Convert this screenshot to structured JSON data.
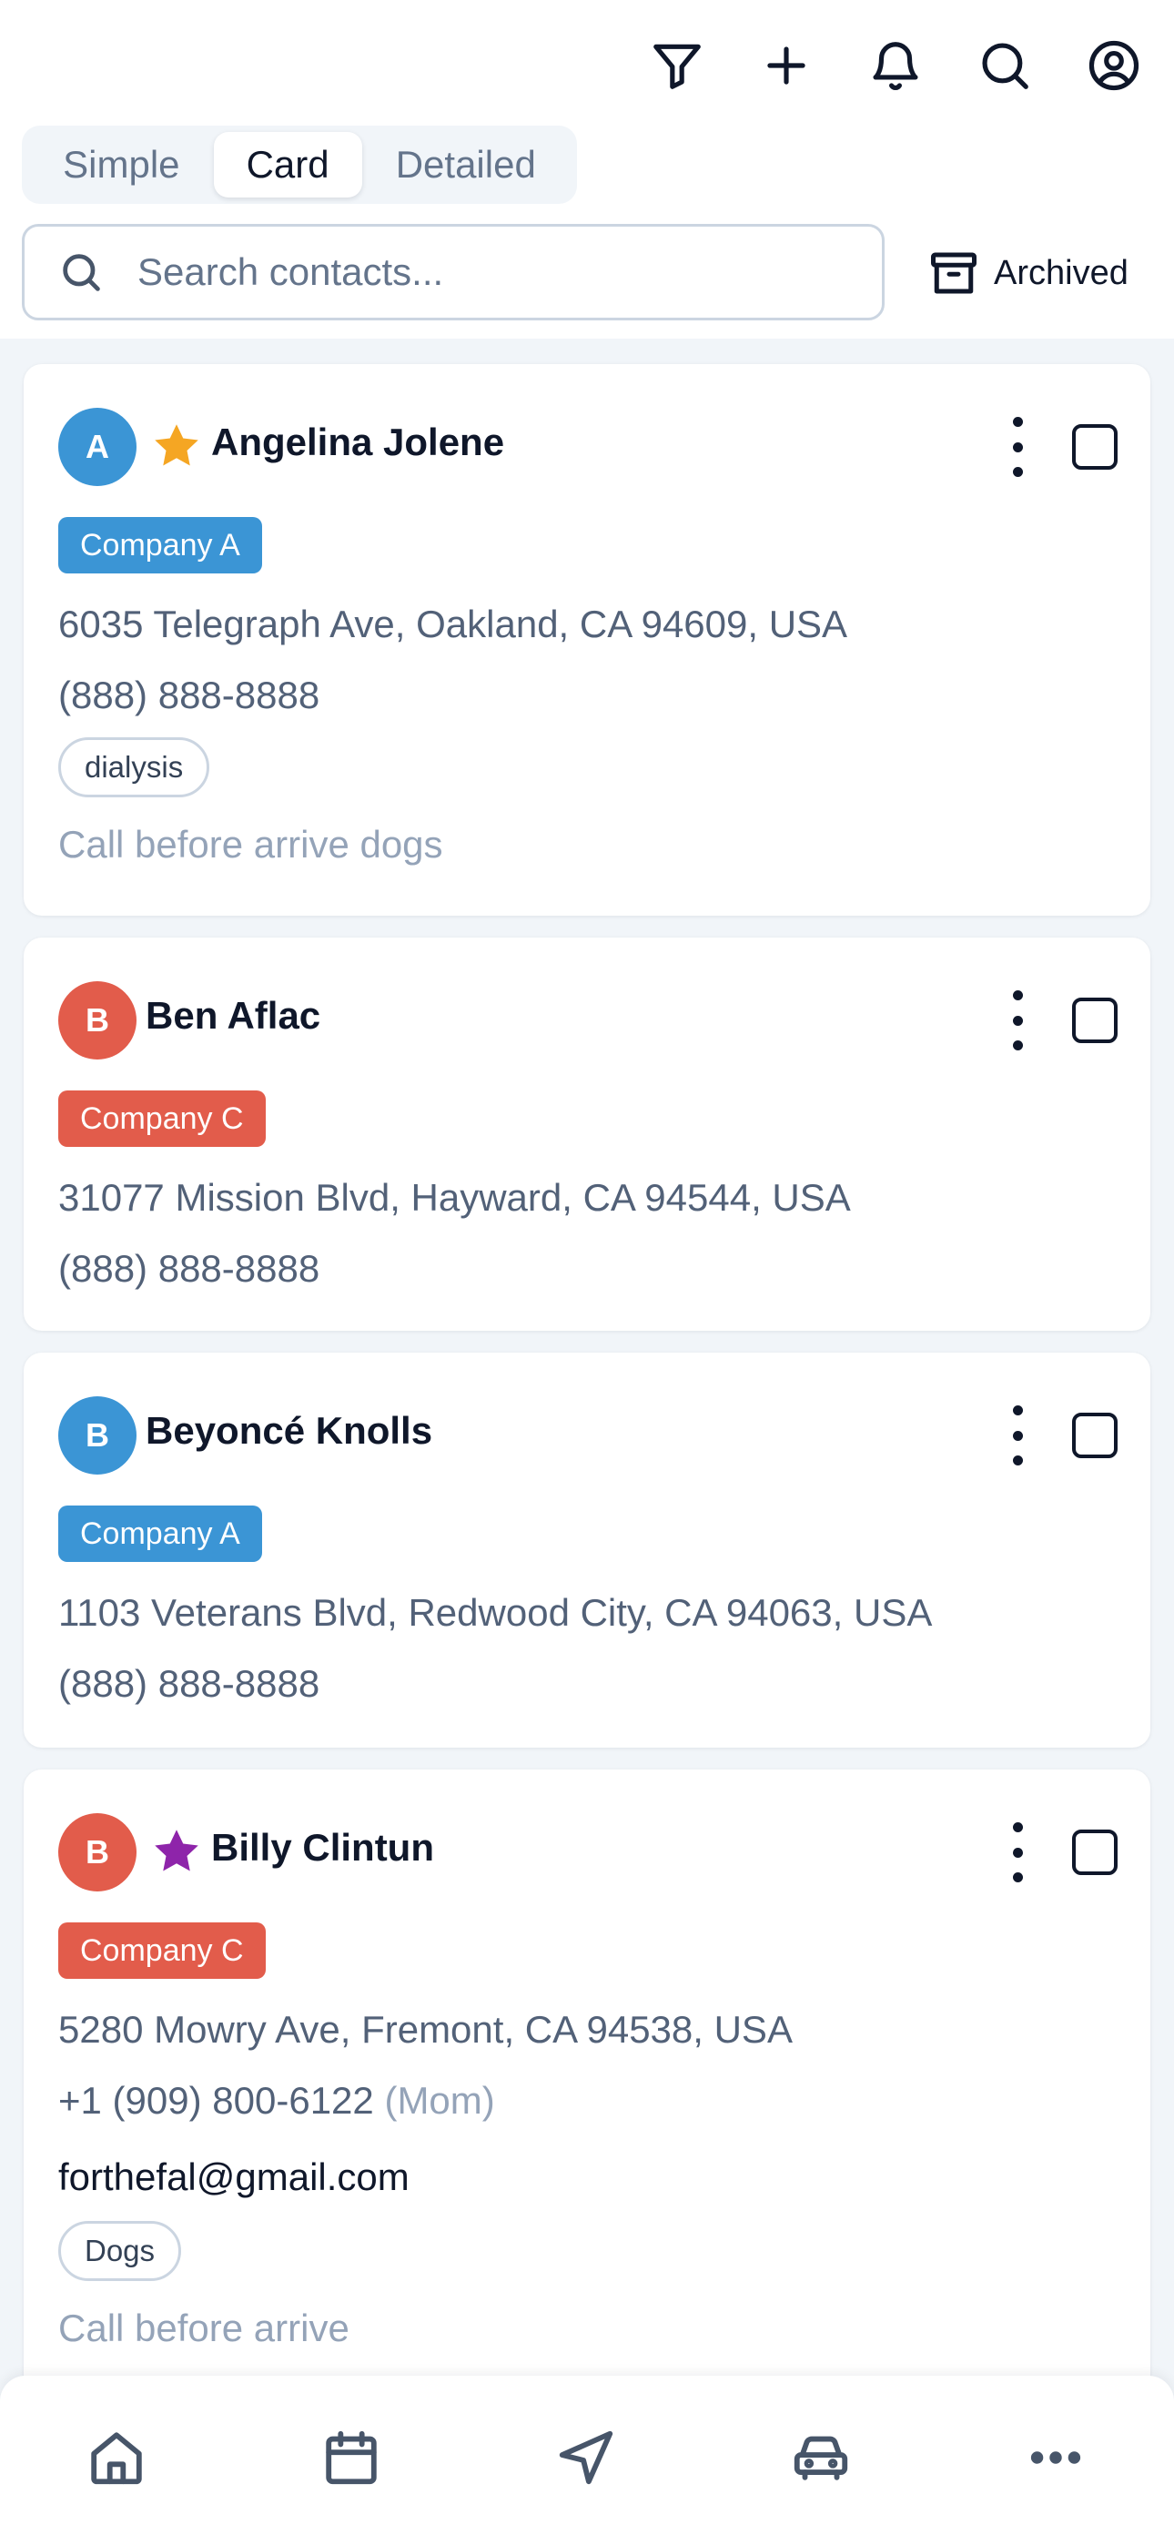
{
  "header": {
    "icons": [
      "filter-icon",
      "plus-icon",
      "bell-icon",
      "search-icon",
      "account-icon"
    ]
  },
  "view_toggle": {
    "tabs": [
      {
        "label": "Simple",
        "active": false
      },
      {
        "label": "Card",
        "active": true
      },
      {
        "label": "Detailed",
        "active": false
      }
    ]
  },
  "search": {
    "placeholder": "Search contacts...",
    "value": ""
  },
  "archived": {
    "label": "Archived"
  },
  "colors": {
    "blue": "#3b95d5",
    "red": "#e25c4b",
    "star_gold": "#f5a623",
    "star_purple": "#8e24aa"
  },
  "contacts": [
    {
      "initial": "A",
      "avatar_color": "#3b95d5",
      "starred": true,
      "star_color": "#f5a623",
      "name": "Angelina Jolene",
      "company": "Company A",
      "company_color": "#3b95d5",
      "address": "6035 Telegraph Ave, Oakland, CA 94609, USA",
      "phone": "(888) 888-8888",
      "tag": "dialysis",
      "note": "Call before arrive dogs"
    },
    {
      "initial": "B",
      "avatar_color": "#e25c4b",
      "starred": false,
      "name": "Ben Aflac",
      "company": "Company C",
      "company_color": "#e25c4b",
      "address": "31077 Mission Blvd, Hayward, CA 94544, USA",
      "phone": "(888) 888-8888"
    },
    {
      "initial": "B",
      "avatar_color": "#3b95d5",
      "starred": false,
      "name": "Beyoncé Knolls",
      "company": "Company A",
      "company_color": "#3b95d5",
      "address": "1103 Veterans Blvd, Redwood City, CA 94063, USA",
      "phone": "(888) 888-8888"
    },
    {
      "initial": "B",
      "avatar_color": "#e25c4b",
      "starred": true,
      "star_color": "#8e24aa",
      "name": "Billy Clintun",
      "company": "Company C",
      "company_color": "#e25c4b",
      "address": "5280 Mowry Ave, Fremont, CA 94538, USA",
      "phone": "+1 (909) 800-6122",
      "phone_label": "(Mom)",
      "email": "forthefal@gmail.com",
      "tag": "Dogs",
      "note": "Call before arrive"
    }
  ],
  "bottom_nav": {
    "items": [
      "home-icon",
      "calendar-icon",
      "navigation-icon",
      "car-icon",
      "more-icon"
    ]
  }
}
